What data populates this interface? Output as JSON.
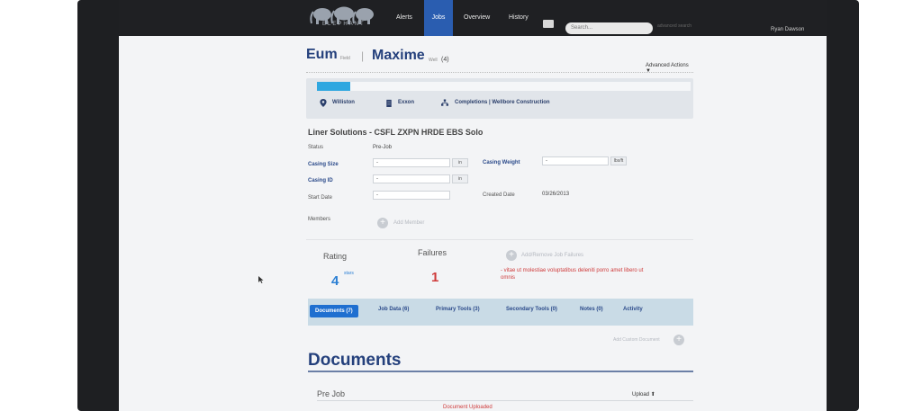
{
  "nav": {
    "logo_text": "ELEPHANT",
    "items": [
      "Alerts",
      "Jobs",
      "Overview",
      "History"
    ],
    "search_placeholder": "Search...",
    "advanced_search": "advanced search",
    "user_name": "Ryan Dawson"
  },
  "header": {
    "field_name": "Eum",
    "field_tag": "Field",
    "well_name": "Maxime",
    "well_tag": "Well",
    "well_count": "(4)",
    "advanced_actions": "Advanced Actions ▼"
  },
  "progress": {
    "fraction": 0.09
  },
  "locations": {
    "city": "Williston",
    "company": "Exxon",
    "service": "Completions | Wellbore Construction"
  },
  "job": {
    "title": "Liner Solutions - CSFL ZXPN HRDE EBS Solo",
    "status_label": "Status",
    "status_value": "Pre-Job",
    "casing_size_label": "Casing Size",
    "casing_size_value": "-",
    "casing_size_unit": "in",
    "casing_weight_label": "Casing Weight",
    "casing_weight_value": "-",
    "casing_weight_unit": "lbs/ft",
    "casing_id_label": "Casing ID",
    "casing_id_value": "-",
    "casing_id_unit": "in",
    "start_date_label": "Start Date",
    "start_date_value": "-",
    "created_date_label": "Created Date",
    "created_date_value": "03/26/2013",
    "members_label": "Members",
    "add_member": "Add Member"
  },
  "stats": {
    "rating_label": "Rating",
    "rating_value": "4",
    "stars_label": "stars",
    "failures_label": "Failures",
    "failures_value": "1",
    "add_failures": "Add/Remove Job Failures",
    "failure_message": "- vitae ut molestiae voluptatibus deleniti porro amet libero ut omnis"
  },
  "tabs": [
    "Documents (7)",
    "Job Data (6)",
    "Primary Tools (3)",
    "Secondary Tools (0)",
    "Notes (0)",
    "Activity"
  ],
  "documents": {
    "add_custom": "Add Custom Document",
    "title": "Documents",
    "section": "Pre Job",
    "upload": "Upload ⬆",
    "uploaded_note": "Document Uploaded"
  },
  "colors": {
    "nav_bg": "#1f2023",
    "nav_active": "#2a5db0",
    "title_blue": "#24407c",
    "progress": "#2fa7e0",
    "failure_red": "#cf3b3b",
    "tab_active": "#1f6fd0"
  }
}
